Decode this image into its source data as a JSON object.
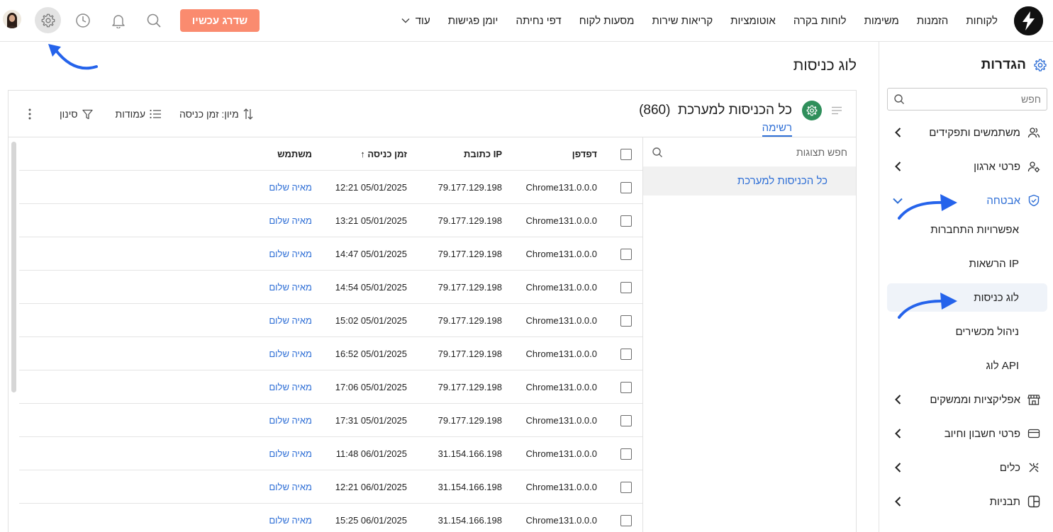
{
  "topbar": {
    "nav": [
      "לקוחות",
      "הזמנות",
      "משימות",
      "לוחות בקרה",
      "אוטומציות",
      "קריאות שירות",
      "מסעות לקוח",
      "דפי נחיתה",
      "יומן פגישות"
    ],
    "more_label": "עוד",
    "upgrade_label": "שדרג עכשיו",
    "icons": [
      "search-icon",
      "bell-icon",
      "clock-icon",
      "gear-icon",
      "avatar"
    ],
    "upgrade_color": "#fa8b6f"
  },
  "sidebar": {
    "title": "הגדרות",
    "search_placeholder": "חפש",
    "sections": [
      {
        "label": "משתמשים ותפקידים",
        "icon": "users-icon"
      },
      {
        "label": "פרטי ארגון",
        "icon": "org-icon"
      },
      {
        "label": "אבטחה",
        "icon": "shield-icon"
      }
    ],
    "security_items": [
      "אפשרויות התחברות",
      "הרשאות IP",
      "לוג כניסות",
      "ניהול מכשירים",
      "לוג API"
    ],
    "active_item": "לוג כניסות",
    "more_sections": [
      {
        "label": "אפליקציות וממשקים",
        "icon": "store-icon"
      },
      {
        "label": "פרטי חשבון וחיוב",
        "icon": "card-icon"
      },
      {
        "label": "כלים",
        "icon": "tools-icon"
      },
      {
        "label": "תבניות",
        "icon": "template-icon"
      }
    ]
  },
  "main": {
    "page_title": "לוג כניסות",
    "view_title": "כל הכניסות למערכת",
    "view_count": "(860)",
    "tab_label": "רשימה",
    "toolbar": {
      "sort_label": "מיון: זמן כניסה",
      "columns_label": "עמודות",
      "filter_label": "סינון"
    },
    "views_search_placeholder": "חפש תצוגות",
    "views_item": "כל הכניסות למערכת",
    "columns": {
      "browser": "דפדפן",
      "ip": "כתובת IP",
      "time": "↑ זמן כניסה",
      "user": "משתמש"
    },
    "rows": [
      {
        "browser": "Chrome131.0.0.0",
        "ip": "79.177.129.198",
        "time": "12:21 05/01/2025",
        "user": "מאיה שלום"
      },
      {
        "browser": "Chrome131.0.0.0",
        "ip": "79.177.129.198",
        "time": "13:21 05/01/2025",
        "user": "מאיה שלום"
      },
      {
        "browser": "Chrome131.0.0.0",
        "ip": "79.177.129.198",
        "time": "14:47 05/01/2025",
        "user": "מאיה שלום"
      },
      {
        "browser": "Chrome131.0.0.0",
        "ip": "79.177.129.198",
        "time": "14:54 05/01/2025",
        "user": "מאיה שלום"
      },
      {
        "browser": "Chrome131.0.0.0",
        "ip": "79.177.129.198",
        "time": "15:02 05/01/2025",
        "user": "מאיה שלום"
      },
      {
        "browser": "Chrome131.0.0.0",
        "ip": "79.177.129.198",
        "time": "16:52 05/01/2025",
        "user": "מאיה שלום"
      },
      {
        "browser": "Chrome131.0.0.0",
        "ip": "79.177.129.198",
        "time": "17:06 05/01/2025",
        "user": "מאיה שלום"
      },
      {
        "browser": "Chrome131.0.0.0",
        "ip": "79.177.129.198",
        "time": "17:31 05/01/2025",
        "user": "מאיה שלום"
      },
      {
        "browser": "Chrome131.0.0.0",
        "ip": "31.154.166.198",
        "time": "11:48 06/01/2025",
        "user": "מאיה שלום"
      },
      {
        "browser": "Chrome131.0.0.0",
        "ip": "31.154.166.198",
        "time": "12:21 06/01/2025",
        "user": "מאיה שלום"
      },
      {
        "browser": "Chrome131.0.0.0",
        "ip": "31.154.166.198",
        "time": "15:25 06/01/2025",
        "user": "מאיה שלום"
      }
    ]
  },
  "colors": {
    "accent": "#2f6fd6",
    "badge": "#2f8f5b",
    "active_bg": "#eff3f9",
    "annotation_arrow": "#2563eb"
  }
}
